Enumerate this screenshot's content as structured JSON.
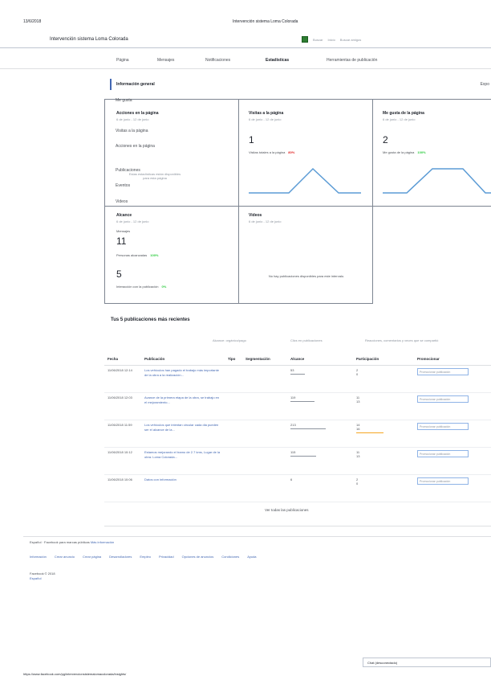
{
  "print": {
    "date": "13/6/2018",
    "title": "Intervención sistema Loma Colorada",
    "url": "https://www.facebook.com/pg/intervencionsistemalomacolorada/insights/"
  },
  "header": {
    "page_name": "Intervención sistema Loma Colorada",
    "search_label": "Buscar",
    "home_label": "Inicio",
    "create_label": "Buscar amigos",
    "thumb_icon": "thumbs-up-icon"
  },
  "tabs": [
    {
      "label": "Página"
    },
    {
      "label": "Mensajes"
    },
    {
      "label": "Notificaciones"
    },
    {
      "label": "Estadísticas"
    },
    {
      "label": "Herramientas de publicación"
    }
  ],
  "overview": {
    "title": "Información general",
    "right_label": "Expo"
  },
  "dropdown": {
    "items": [
      "Me gusta",
      "Acciones en la página",
      "Visitas a la página",
      "Acciones en la página",
      "Publicaciones",
      "Eventos",
      "Videos",
      "Mensajes"
    ],
    "note": "Estas estadísticas están disponibles para esta página"
  },
  "cards": {
    "actions": {
      "title": "Acciones en la página",
      "sub": "6 de junio - 12 de junio"
    },
    "visits": {
      "title": "Visitas a la página",
      "sub": "6 de junio - 12 de junio",
      "value": "1",
      "label": "Visitas totales a la página",
      "change": "80%"
    },
    "likes": {
      "title": "Me gusta de la página",
      "sub": "6 de junio - 12 de junio",
      "value": "2",
      "label": "Me gusta de la página",
      "change": "100%"
    },
    "reach": {
      "title": "Alcance",
      "sub": "6 de junio - 12 de junio",
      "label_a": "Mensajes",
      "value_a": "11",
      "label_b": "Personas alcanzadas",
      "change_b": "100%",
      "value_b": "5",
      "label_c": "Interacción con la publicación",
      "change_c": "0%"
    },
    "videos": {
      "title": "Videos",
      "sub": "6 de junio - 12 de junio",
      "empty": "No hay publicaciones disponibles para este intervalo."
    }
  },
  "posts": {
    "title": "Tus 5 publicaciones más recientes",
    "legend": [
      "Alcance: orgánico/pago",
      "Clics en publicaciones",
      "Reacciones, comentarios y veces que se compartió"
    ],
    "headers": [
      "Fecha",
      "Publicación",
      "Tipo",
      "Segmentación",
      "Alcance",
      "Participación",
      "Promocionar"
    ],
    "rows": [
      {
        "date": "11/06/2018 12:14",
        "text": "Los vehículos han pagado el trabajo más importante de la obra a la realización...",
        "reach": "53",
        "eng_a": "2",
        "eng_b": "0",
        "promo": "Promocionar publicación"
      },
      {
        "date": "11/06/2018 12:03",
        "text": "Avance de la primera etapa de la obra, se trabajo en el mejoramiento...",
        "reach": "119",
        "eng_a": "11",
        "eng_b": "13",
        "promo": "Promocionar publicación"
      },
      {
        "date": "11/06/2018 11:59",
        "text": "Los vehículos que intentan circular cada dia pueden ser el alcance de la...",
        "reach": "213",
        "eng_a": "14",
        "eng_b": "16",
        "promo": "Promocionar publicación"
      },
      {
        "date": "11/06/2018 10:12",
        "text": "Estamos mejorando el tramo de 2.7 kms, Lugar de la obra: Loma Colorada...",
        "reach": "115",
        "eng_a": "11",
        "eng_b": "13",
        "promo": "Promocionar publicación"
      },
      {
        "date": "11/06/2018 10:06",
        "text": "Datos con información",
        "reach": "6",
        "eng_a": "2",
        "eng_b": "0",
        "promo": "Promocionar publicación"
      }
    ],
    "see_all": "Ver todas las publicaciones"
  },
  "footer": {
    "lang_prefix": "Español · Facebook para marcas públicas",
    "lang_link": "Más información",
    "links": [
      "Información",
      "Crear anuncio",
      "Crear página",
      "Desarrolladores",
      "Empleo",
      "Privacidad",
      "Opciones de anuncios",
      "Condiciones",
      "Ayuda"
    ],
    "copyright": "Facebook © 2018",
    "language": "Español"
  },
  "chat": {
    "label": "Chat (desconectado)"
  }
}
